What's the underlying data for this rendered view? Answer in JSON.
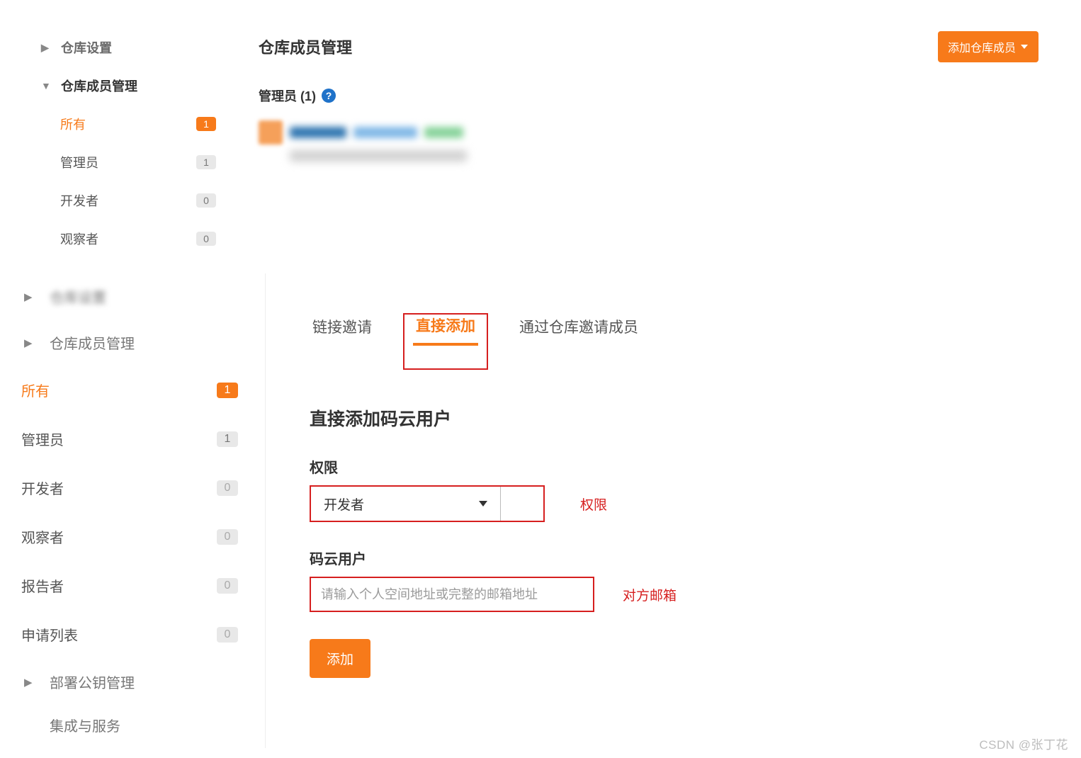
{
  "top": {
    "sidebar": {
      "settings": "仓库设置",
      "members": "仓库成员管理",
      "items": [
        {
          "label": "所有",
          "count": "1",
          "active": true
        },
        {
          "label": "管理员",
          "count": "1",
          "active": false
        },
        {
          "label": "开发者",
          "count": "0",
          "active": false
        },
        {
          "label": "观察者",
          "count": "0",
          "active": false
        }
      ]
    },
    "main": {
      "title": "仓库成员管理",
      "add_button": "添加仓库成员",
      "admins_label": "管理员 (1)"
    }
  },
  "bottom": {
    "sidebar": {
      "first_blur": "仓库设置",
      "members": "仓库成员管理",
      "items": [
        {
          "label": "所有",
          "count": "1",
          "active": true
        },
        {
          "label": "管理员",
          "count": "1"
        },
        {
          "label": "开发者",
          "count": "0"
        },
        {
          "label": "观察者",
          "count": "0"
        },
        {
          "label": "报告者",
          "count": "0"
        },
        {
          "label": "申请列表",
          "count": "0"
        }
      ],
      "deploy": "部署公钥管理",
      "integrations": "集成与服务"
    },
    "main": {
      "tabs": {
        "link": "链接邀请",
        "direct": "直接添加",
        "repo": "通过仓库邀请成员"
      },
      "heading": "直接添加码云用户",
      "perm_label": "权限",
      "perm_value": "开发者",
      "perm_annot": "权限",
      "user_label": "码云用户",
      "user_placeholder": "请输入个人空间地址或完整的邮箱地址",
      "user_annot": "对方邮箱",
      "submit": "添加"
    }
  },
  "watermark": "CSDN @张丁花"
}
